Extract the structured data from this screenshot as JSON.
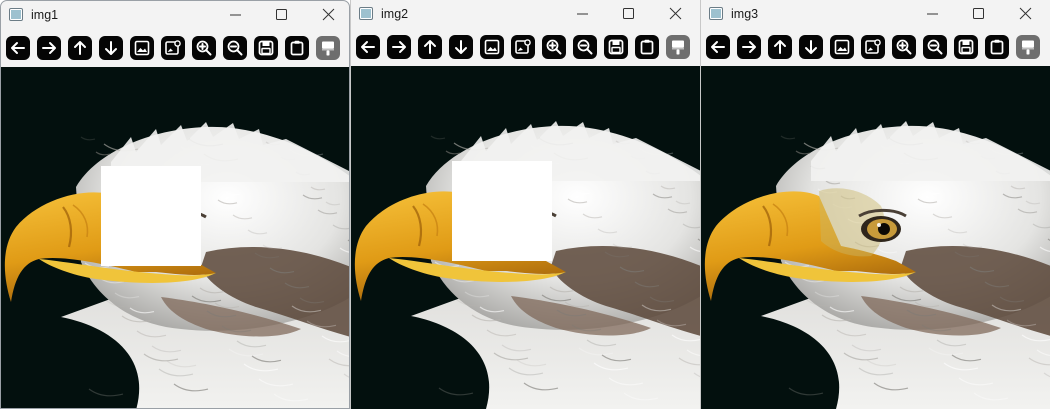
{
  "windows": [
    {
      "title": "img1",
      "occluded": true
    },
    {
      "title": "img2",
      "occluded": true
    },
    {
      "title": "img3",
      "occluded": false
    }
  ],
  "toolbar_icons": [
    "arrow-left-icon",
    "arrow-right-icon",
    "arrow-up-icon",
    "arrow-down-icon",
    "image-icon",
    "image-edit-icon",
    "zoom-in-icon",
    "zoom-out-icon",
    "save-icon",
    "clipboard-icon",
    "paint-bucket-icon"
  ],
  "colors": {
    "background": "#03100e",
    "beak": "#e7a51c",
    "feathers": "#e6e6e6",
    "button": "#050505",
    "button_alt": "#6e6e6e",
    "occluder": "#ffffff"
  }
}
